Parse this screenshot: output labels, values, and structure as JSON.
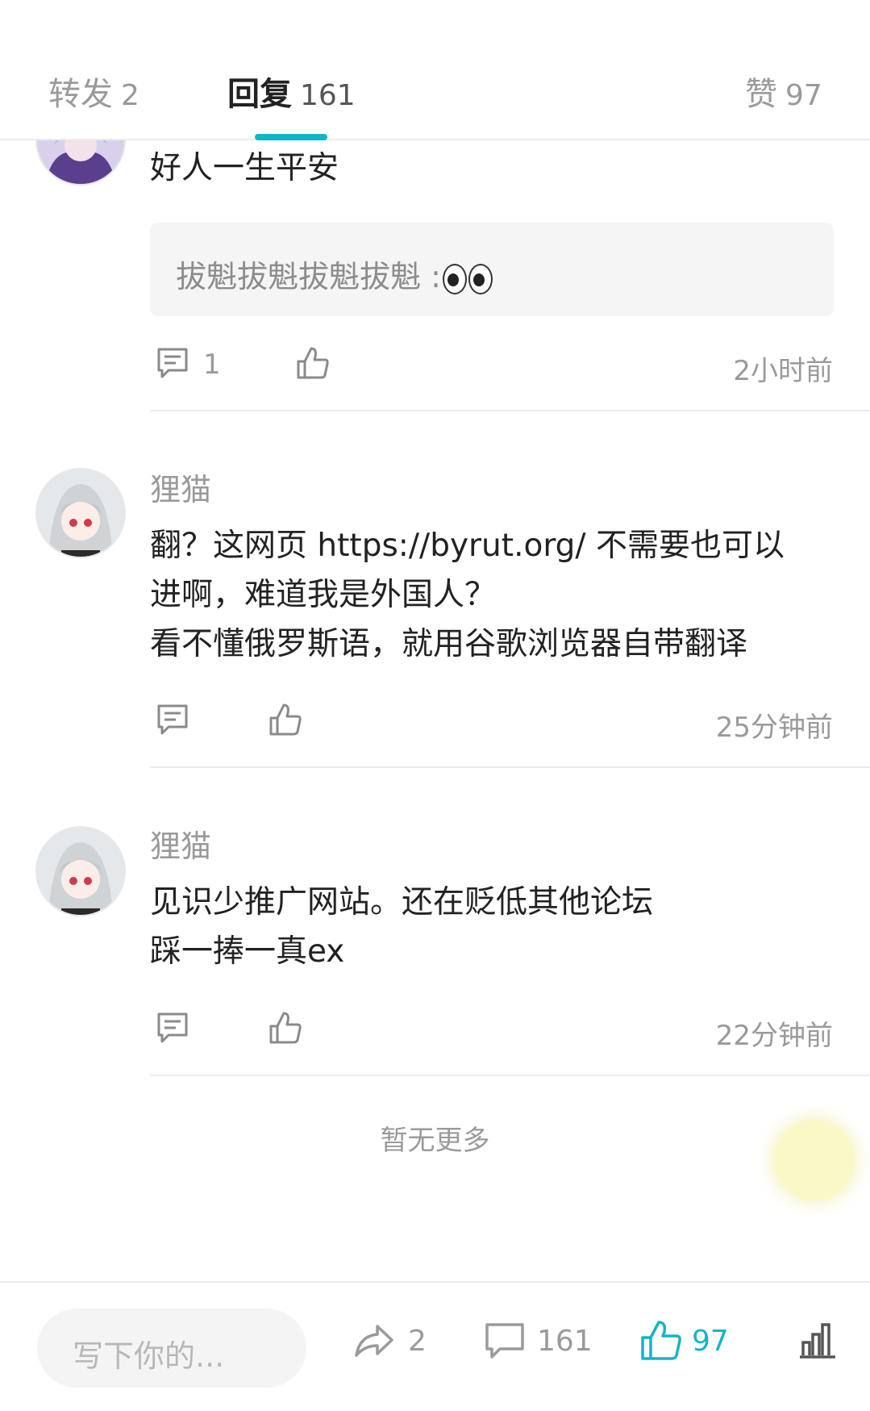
{
  "tabs": [
    {
      "label": "转发",
      "count": "2"
    },
    {
      "label": "回复",
      "count": "161"
    },
    {
      "label": "赞",
      "count": "97"
    }
  ],
  "comments": [
    {
      "text_lines": [
        "好人一生平安"
      ],
      "quote": "拔魁拔魁拔魁拔魁 :",
      "reply_count": "1",
      "time": "2小时前"
    },
    {
      "name": "狸猫",
      "text_lines": [
        "翻？这网页 https://byrut.org/ 不需要也可以",
        "进啊，难道我是外国人？",
        "看不懂俄罗斯语，就用谷歌浏览器自带翻译"
      ],
      "time": "25分钟前"
    },
    {
      "name": "狸猫",
      "text_lines": [
        "见识少推广网站。还在贬低其他论坛",
        "踩一捧一真ex"
      ],
      "time": "22分钟前"
    }
  ],
  "footer_note": "暂无更多",
  "bottombar": {
    "input_placeholder": "写下你的...",
    "share_count": "2",
    "comment_count": "161",
    "like_count": "97"
  },
  "colors": {
    "accent": "#16b3c7",
    "text": "#222222",
    "muted": "#9a9a9a"
  }
}
